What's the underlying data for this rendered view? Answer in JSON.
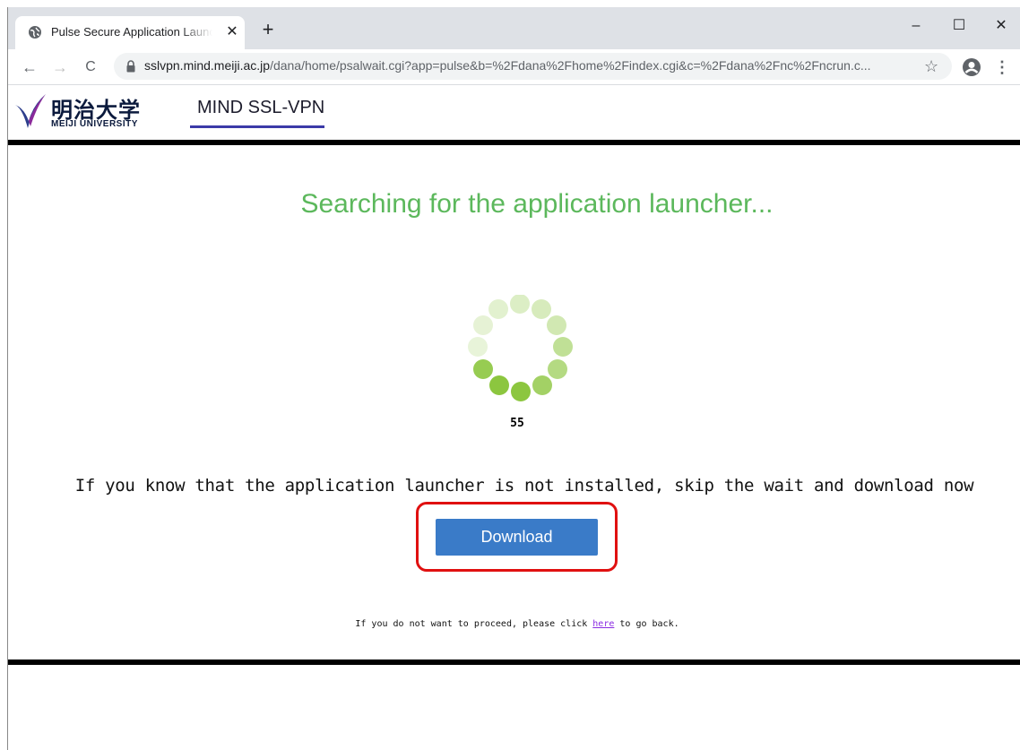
{
  "browser": {
    "tab": {
      "title": "Pulse Secure Application Launcher",
      "favicon": "globe-icon"
    },
    "url": {
      "host": "sslvpn.mind.meiji.ac.jp",
      "path": "/dana/home/psalwait.cgi?app=pulse&b=%2Fdana%2Fhome%2Findex.cgi&c=%2Fdana%2Fnc%2Fncrun.c..."
    },
    "tab_close_glyph": "✕",
    "new_tab_glyph": "+",
    "controls": {
      "minimize": "–",
      "maximize": "☐",
      "close": "✕"
    },
    "nav": {
      "back": "←",
      "forward": "→",
      "reload": "C"
    },
    "star_glyph": "☆",
    "menu_glyph": "⋮"
  },
  "header": {
    "logo_jp": "明治大学",
    "logo_en": "MEIJI UNIVERSITY",
    "brand": "MIND SSL-VPN"
  },
  "main": {
    "headline": "Searching for the application launcher...",
    "counter": "55",
    "prompt": "If you know that the application launcher is not installed, skip the wait and download now",
    "download_label": "Download",
    "footnote_before": "If you do not want to proceed, please click ",
    "footnote_link": "here",
    "footnote_after": " to go back."
  },
  "colors": {
    "headline": "#5cb85c",
    "button": "#3a7bc8",
    "highlight": "#e01010",
    "spinner": "#8cc63f"
  }
}
